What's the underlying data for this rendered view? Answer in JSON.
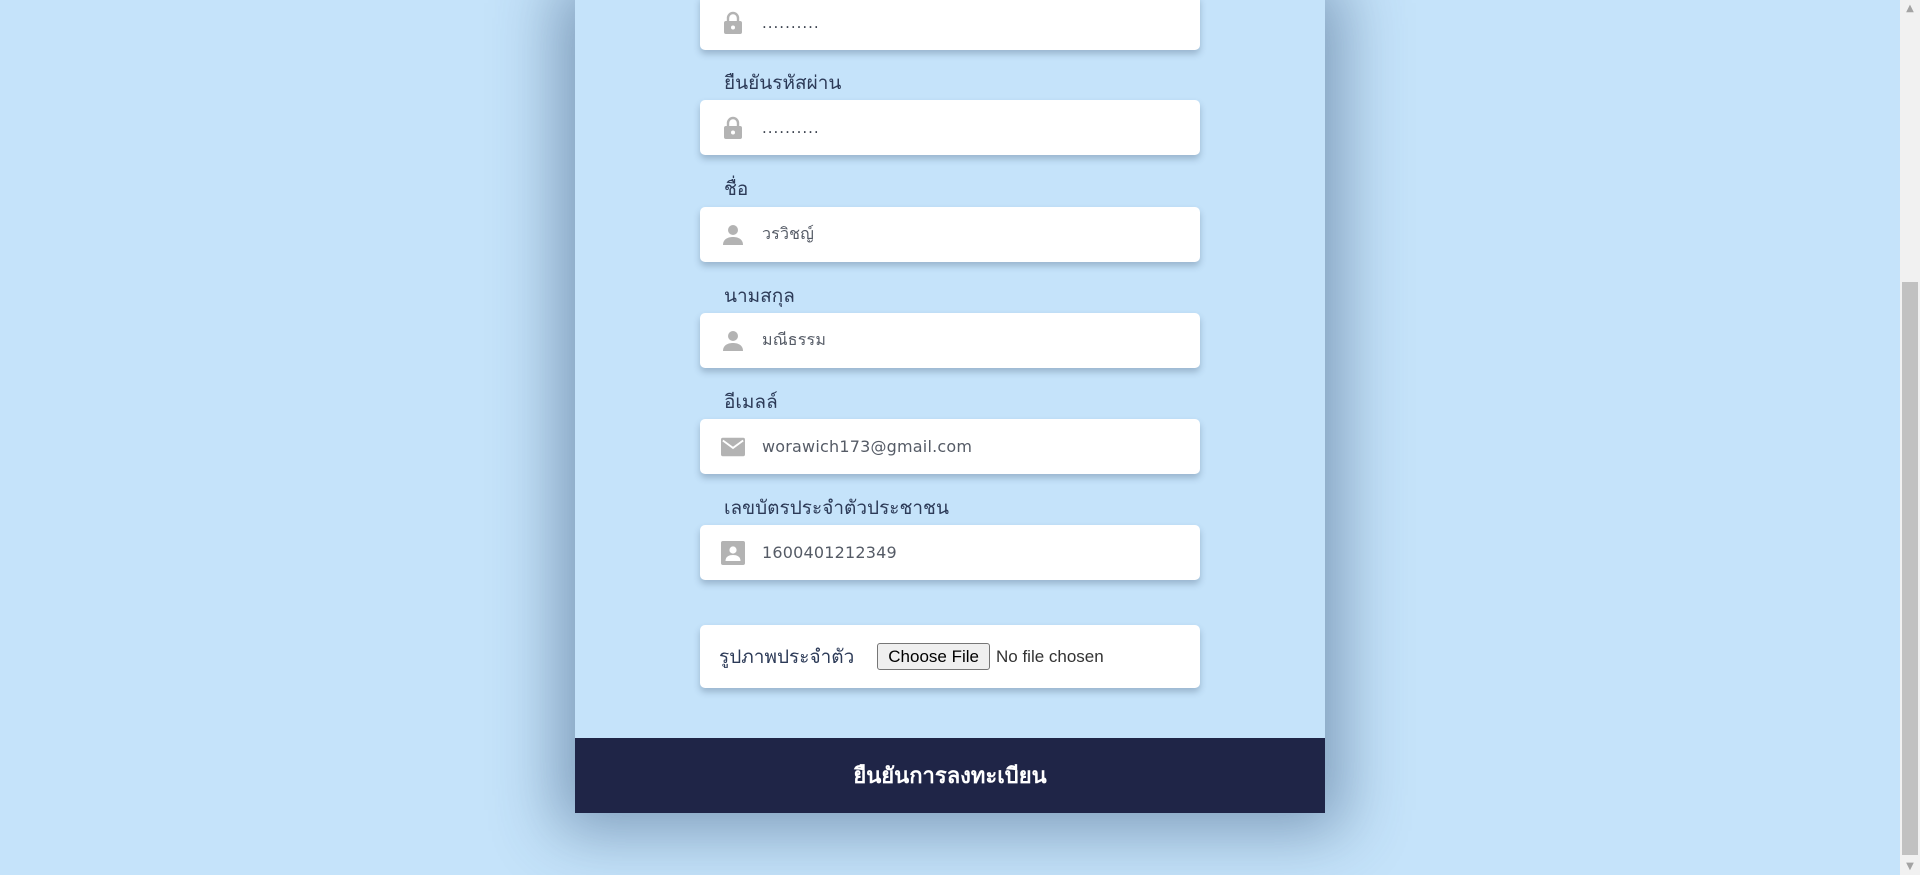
{
  "form": {
    "fields": [
      {
        "label": "",
        "value": "..........",
        "icon": "lock-icon"
      },
      {
        "label": "ยืนยันรหัสผ่าน",
        "value": "..........",
        "icon": "lock-icon"
      },
      {
        "label": "ชื่อ",
        "value": "วรวิชญ์",
        "icon": "person-icon"
      },
      {
        "label": "นามสกุล",
        "value": "มณีธรรม",
        "icon": "person-icon"
      },
      {
        "label": "อีเมลล์",
        "value": "worawich173@gmail.com",
        "icon": "mail-icon"
      },
      {
        "label": "เลขบัตรประจำตัวประชาชน",
        "value": "1600401212349",
        "icon": "id-card-icon"
      }
    ],
    "photo": {
      "label": "รูปภาพประจำตัว",
      "button_label": "Choose File",
      "status": "No file chosen"
    },
    "submit_label": "ยืนยันการลงทะเบียน"
  },
  "colors": {
    "background": "#c5e3fa",
    "submit_bg": "#1f2547",
    "icon": "#b3b3b3"
  }
}
